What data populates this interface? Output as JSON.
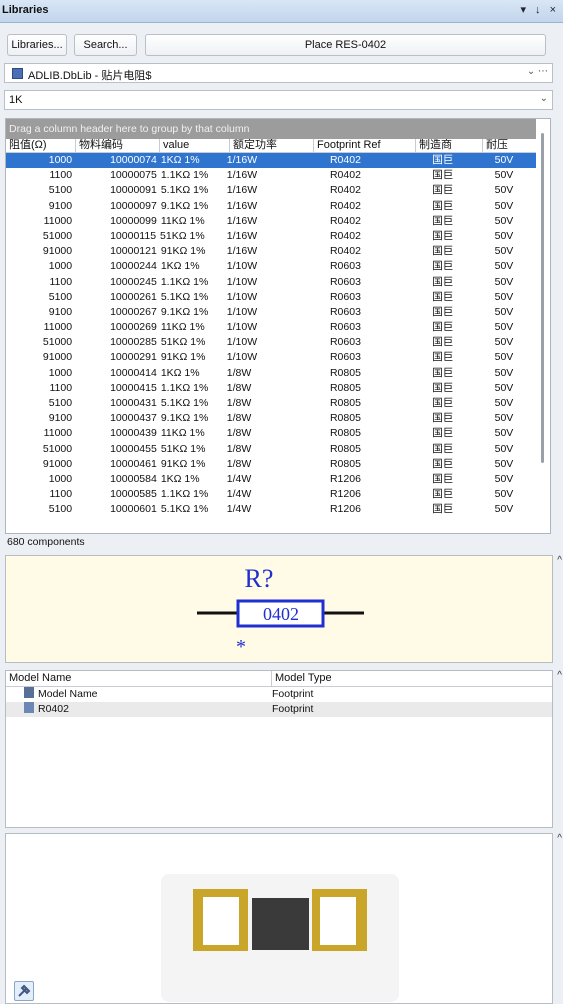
{
  "window": {
    "title": "Libraries",
    "controls": "▾ ↓ ×"
  },
  "toolbar": {
    "libraries_label": "Libraries...",
    "search_label": "Search...",
    "place_label": "Place RES-0402"
  },
  "library_select": {
    "value": "ADLIB.DbLib - 贴片电阻$"
  },
  "filter": {
    "value": "1K"
  },
  "grid": {
    "group_hint": "Drag a column header here to group by that column",
    "columns": [
      "阻值(Ω)",
      "物料编码",
      "value",
      "额定功率",
      "Footprint Ref",
      "制造商",
      "耐压"
    ],
    "rows": [
      [
        "1000",
        "10000074",
        "1KΩ 1%",
        "1/16W",
        "R0402",
        "国巨",
        "50V"
      ],
      [
        "1100",
        "10000075",
        "1.1KΩ 1%",
        "1/16W",
        "R0402",
        "国巨",
        "50V"
      ],
      [
        "5100",
        "10000091",
        "5.1KΩ 1%",
        "1/16W",
        "R0402",
        "国巨",
        "50V"
      ],
      [
        "9100",
        "10000097",
        "9.1KΩ 1%",
        "1/16W",
        "R0402",
        "国巨",
        "50V"
      ],
      [
        "11000",
        "10000099",
        "11KΩ 1%",
        "1/16W",
        "R0402",
        "国巨",
        "50V"
      ],
      [
        "51000",
        "10000115",
        "51KΩ 1%",
        "1/16W",
        "R0402",
        "国巨",
        "50V"
      ],
      [
        "91000",
        "10000121",
        "91KΩ 1%",
        "1/16W",
        "R0402",
        "国巨",
        "50V"
      ],
      [
        "1000",
        "10000244",
        "1KΩ 1%",
        "1/10W",
        "R0603",
        "国巨",
        "50V"
      ],
      [
        "1100",
        "10000245",
        "1.1KΩ 1%",
        "1/10W",
        "R0603",
        "国巨",
        "50V"
      ],
      [
        "5100",
        "10000261",
        "5.1KΩ 1%",
        "1/10W",
        "R0603",
        "国巨",
        "50V"
      ],
      [
        "9100",
        "10000267",
        "9.1KΩ 1%",
        "1/10W",
        "R0603",
        "国巨",
        "50V"
      ],
      [
        "11000",
        "10000269",
        "11KΩ 1%",
        "1/10W",
        "R0603",
        "国巨",
        "50V"
      ],
      [
        "51000",
        "10000285",
        "51KΩ 1%",
        "1/10W",
        "R0603",
        "国巨",
        "50V"
      ],
      [
        "91000",
        "10000291",
        "91KΩ 1%",
        "1/10W",
        "R0603",
        "国巨",
        "50V"
      ],
      [
        "1000",
        "10000414",
        "1KΩ 1%",
        "1/8W",
        "R0805",
        "国巨",
        "50V"
      ],
      [
        "1100",
        "10000415",
        "1.1KΩ 1%",
        "1/8W",
        "R0805",
        "国巨",
        "50V"
      ],
      [
        "5100",
        "10000431",
        "5.1KΩ 1%",
        "1/8W",
        "R0805",
        "国巨",
        "50V"
      ],
      [
        "9100",
        "10000437",
        "9.1KΩ 1%",
        "1/8W",
        "R0805",
        "国巨",
        "50V"
      ],
      [
        "11000",
        "10000439",
        "11KΩ 1%",
        "1/8W",
        "R0805",
        "国巨",
        "50V"
      ],
      [
        "51000",
        "10000455",
        "51KΩ 1%",
        "1/8W",
        "R0805",
        "国巨",
        "50V"
      ],
      [
        "91000",
        "10000461",
        "91KΩ 1%",
        "1/8W",
        "R0805",
        "国巨",
        "50V"
      ],
      [
        "1000",
        "10000584",
        "1KΩ 1%",
        "1/4W",
        "R1206",
        "国巨",
        "50V"
      ],
      [
        "1100",
        "10000585",
        "1.1KΩ 1%",
        "1/4W",
        "R1206",
        "国巨",
        "50V"
      ],
      [
        "5100",
        "10000601",
        "5.1KΩ 1%",
        "1/4W",
        "R1206",
        "国巨",
        "50V"
      ]
    ]
  },
  "status": {
    "count_text": "680 components"
  },
  "symbol": {
    "designator": "R?",
    "value": "0402",
    "marker": "*"
  },
  "models": {
    "columns": [
      "Model Name",
      "Model Type"
    ],
    "rows": [
      {
        "name": "Model Name",
        "type": "Footprint"
      },
      {
        "name": "R0402",
        "type": "Footprint"
      }
    ]
  },
  "colors": {
    "selection": "#2f74cf",
    "symbol_blue": "#1f2fd0",
    "pad_gold": "#c9a52a",
    "body_gray": "#3a3a3a"
  }
}
